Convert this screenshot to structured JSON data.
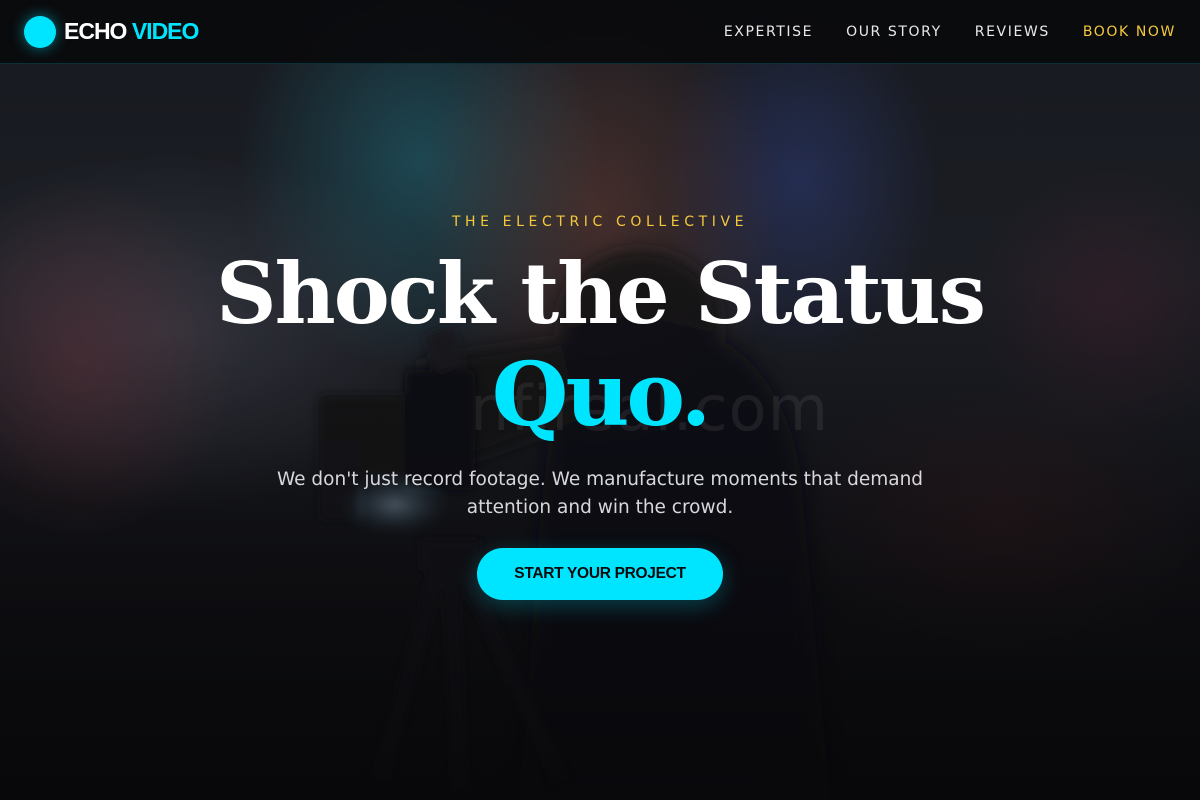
{
  "brand": {
    "name_primary": "ECHO",
    "name_accent": "VIDEO",
    "logo_icon": "circle-logo-icon",
    "accent_color": "#00e5ff"
  },
  "nav": {
    "items": [
      {
        "label": "EXPERTISE"
      },
      {
        "label": "OUR STORY"
      },
      {
        "label": "REVIEWS"
      },
      {
        "label": "BOOK NOW",
        "accent_color": "#f5c83c"
      }
    ]
  },
  "hero": {
    "eyebrow": "THE ELECTRIC COLLECTIVE",
    "headline": "Shock the Status",
    "headline_accent": "Quo.",
    "subtext": "We don't just record footage. We manufacture moments that demand attention and win the crowd.",
    "cta_label": "START YOUR PROJECT",
    "background_image": "blurred-cinema-camera-operator",
    "watermark": "nfireal.com"
  },
  "colors": {
    "cyan": "#00e5ff",
    "gold": "#f5c83c",
    "background": "#0a0a0c"
  }
}
